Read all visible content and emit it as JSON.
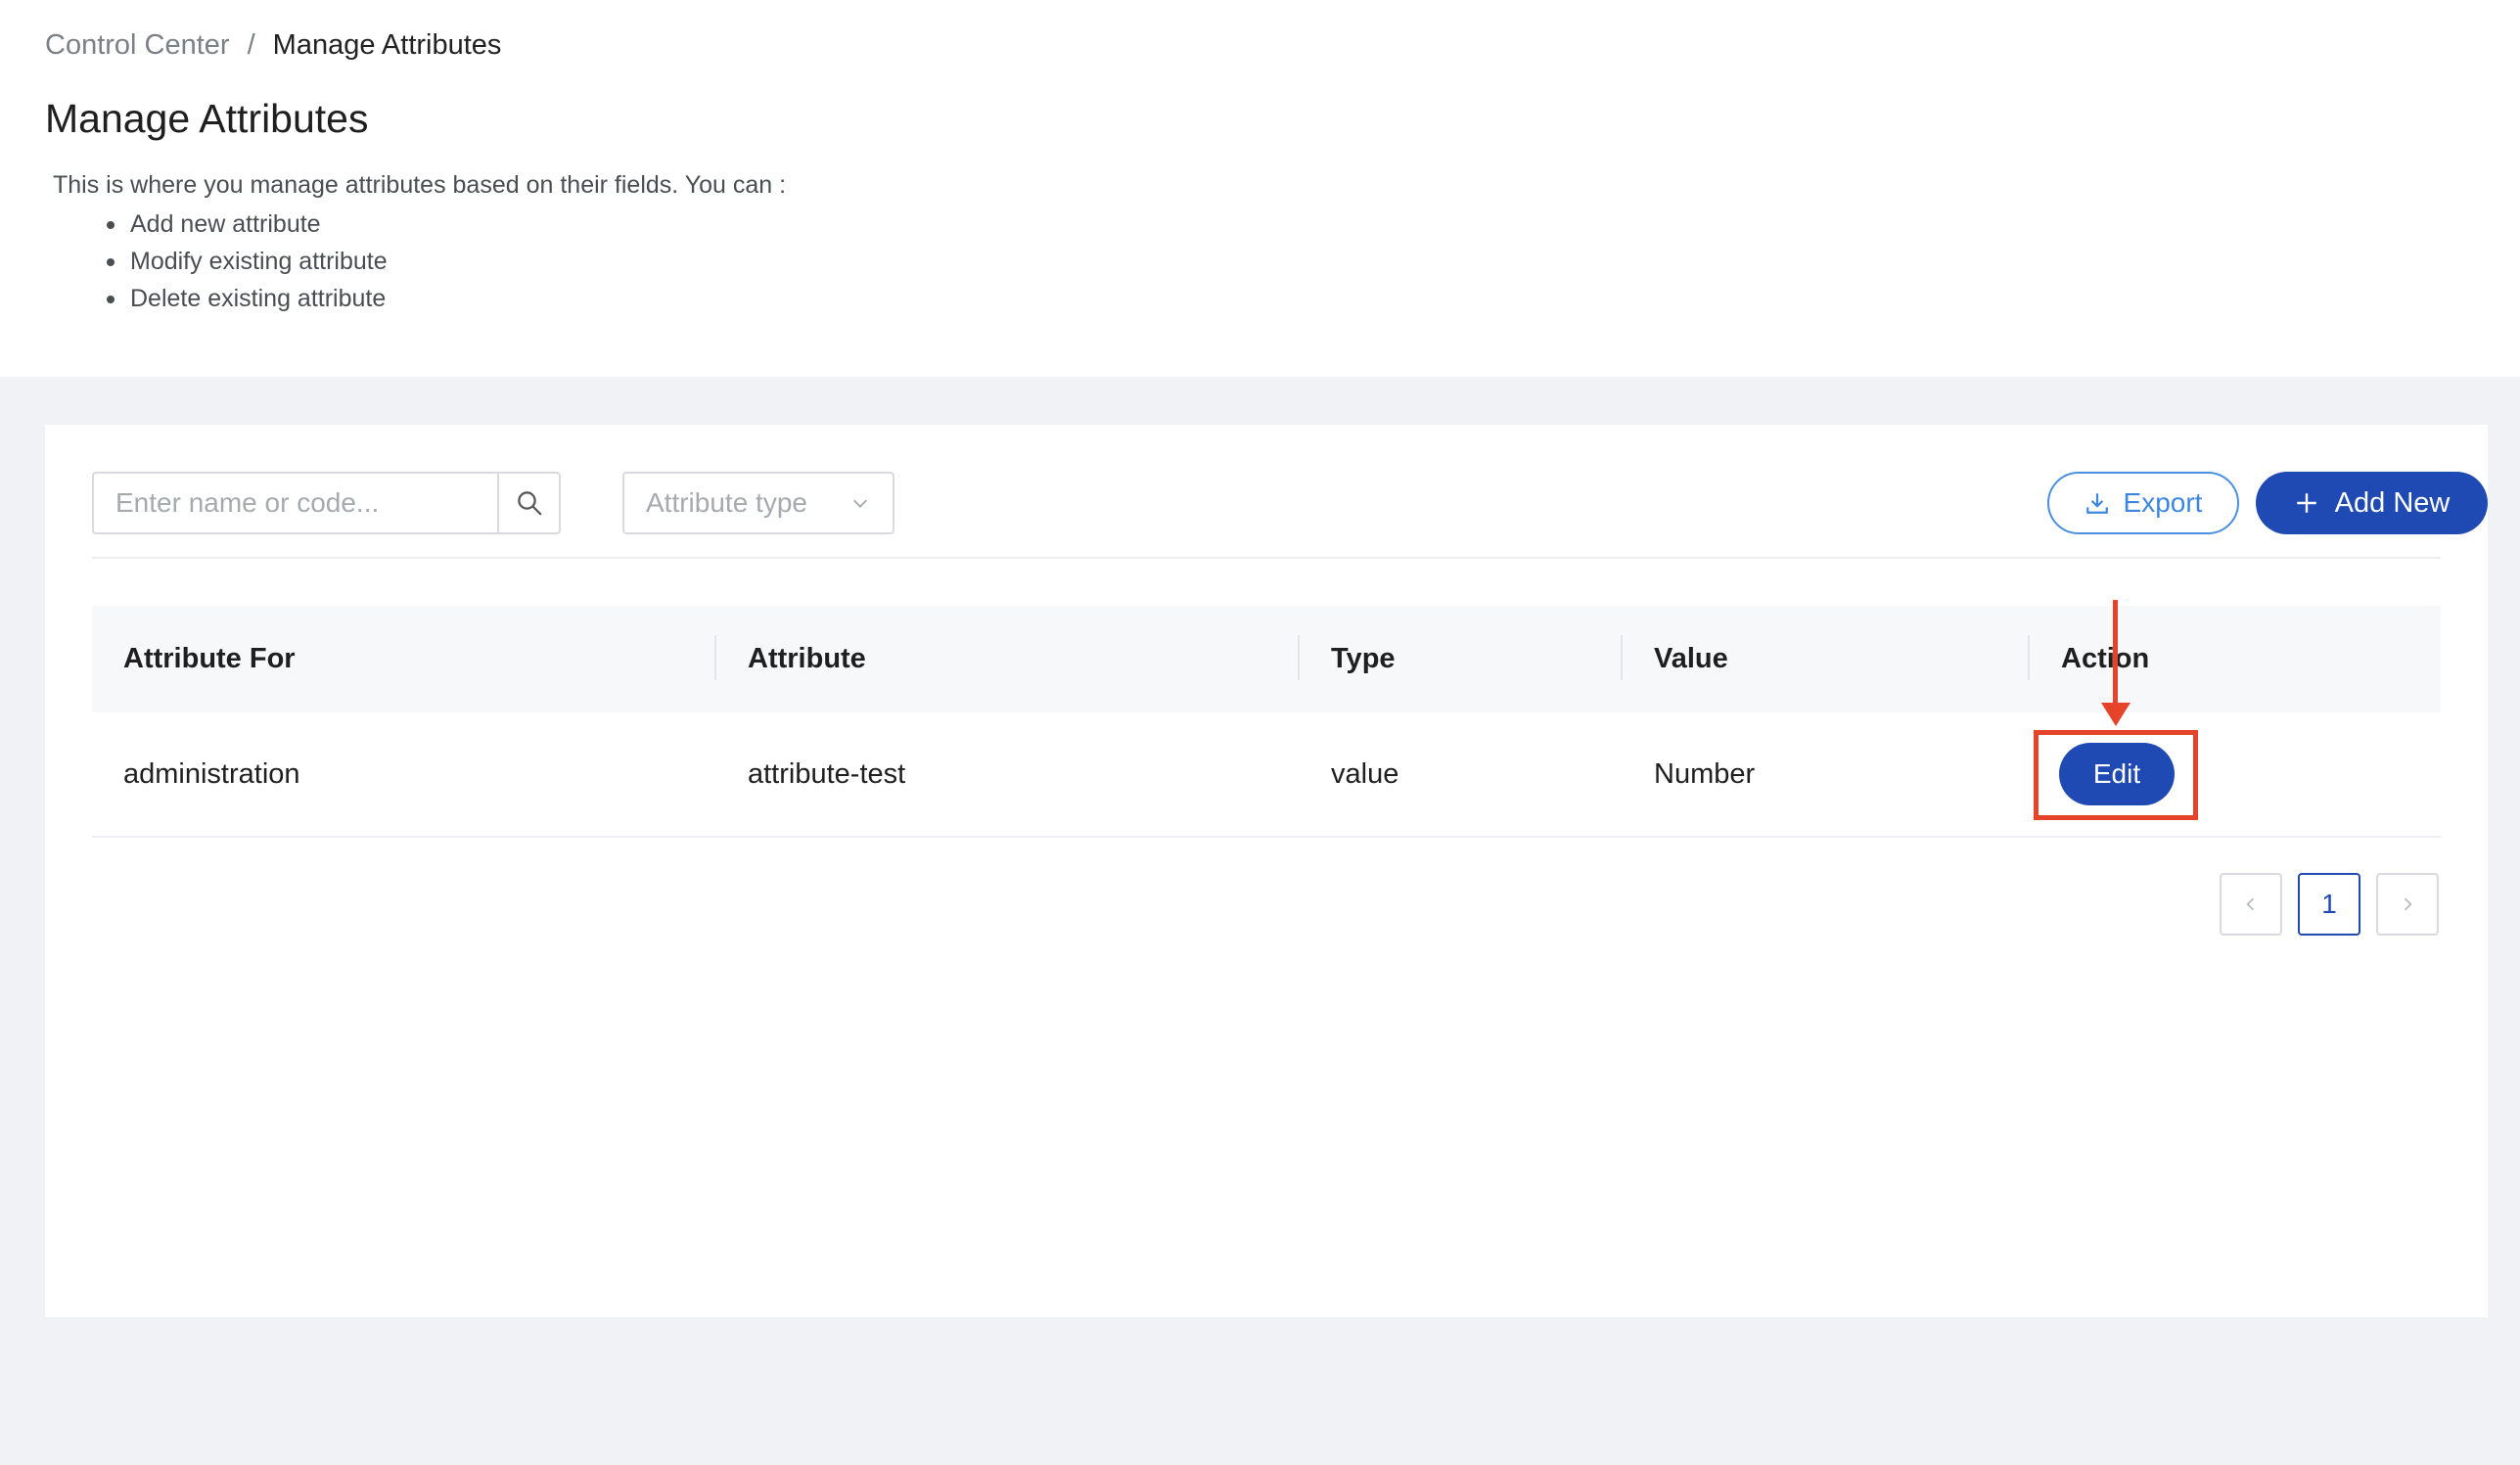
{
  "breadcrumb": {
    "root": "Control Center",
    "separator": "/",
    "current": "Manage Attributes"
  },
  "page": {
    "title": "Manage Attributes",
    "description": "This is where you manage attributes based on their fields. You can :",
    "bullets": [
      "Add new attribute",
      "Modify existing attribute",
      "Delete existing attribute"
    ]
  },
  "toolbar": {
    "search_placeholder": "Enter name or code...",
    "search_icon": "search-icon",
    "type_placeholder": "Attribute type",
    "export_label": "Export",
    "add_label": "Add New"
  },
  "table": {
    "headers": [
      "Attribute For",
      "Attribute",
      "Type",
      "Value",
      "Action"
    ],
    "rows": [
      {
        "attribute_for": "administration",
        "attribute": "attribute-test",
        "type": "value",
        "value": "Number",
        "action": "Edit"
      }
    ]
  },
  "pagination": {
    "current_page": "1"
  },
  "colors": {
    "primary": "#1f4ab3",
    "export": "#3c86e0",
    "annotation": "#e5432a"
  }
}
